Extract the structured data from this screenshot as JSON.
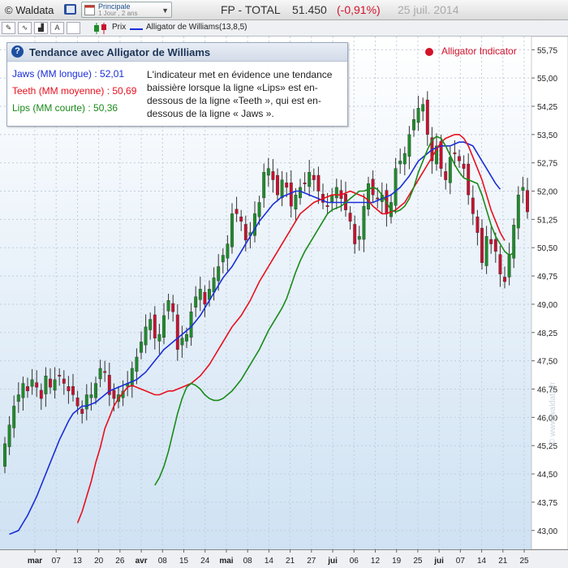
{
  "header": {
    "app_name": "© Waldata",
    "period_main": "Principale",
    "period_sub": "1 Jour , 2 ans",
    "instrument": "FP - TOTAL",
    "price": "51.450",
    "change": "(-0,91%)",
    "date": "25 juil. 2014"
  },
  "toolbar": {
    "legend_price": "Prix",
    "legend_alligator": "Alligator de Williams(13,8,5)"
  },
  "info": {
    "title": "Tendance avec Alligator de Williams",
    "jaws": "Jaws  (MM longue)  : 52,01",
    "teeth": "Teeth (MM moyenne) : 50,69",
    "lips": "Lips  (MM courte)  : 50,36",
    "description": "L'indicateur met en évidence une tendance baissière lorsque la ligne «Lips» est en-dessous de la ligne «Teeth », qui est en-dessous de la ligne « Jaws »."
  },
  "indicator_label": "Alligator Indicator",
  "watermark_text": "© www.waldata.fr",
  "colors": {
    "jaws": "#1a2ed8",
    "teeth": "#e8101e",
    "lips": "#1a8a1a",
    "up": "#1e8c2a",
    "down": "#c8102e"
  },
  "chart_data": {
    "type": "candlestick",
    "ylim": [
      42.5,
      56.1
    ],
    "yticks": [
      "43,00",
      "43,75",
      "44,50",
      "45,25",
      "46,00",
      "46,75",
      "47,50",
      "48,25",
      "49,00",
      "49,75",
      "50,50",
      "51,25",
      "52,00",
      "52,75",
      "53,50",
      "54,25",
      "55,00",
      "55,75"
    ],
    "xticks": [
      "mar",
      "07",
      "13",
      "20",
      "26",
      "avr",
      "08",
      "15",
      "24",
      "mai",
      "08",
      "14",
      "21",
      "27",
      "jui",
      "06",
      "12",
      "19",
      "25",
      "jui",
      "07",
      "14",
      "21",
      "25"
    ],
    "closes": [
      45.3,
      45.8,
      46.3,
      46.6,
      46.9,
      46.7,
      47.0,
      46.8,
      46.5,
      47.1,
      46.8,
      47.0,
      47.1,
      46.9,
      46.7,
      46.6,
      46.3,
      46.1,
      46.6,
      46.6,
      46.9,
      47.3,
      47.2,
      46.6,
      46.5,
      46.6,
      46.7,
      46.9,
      47.3,
      47.6,
      48.0,
      48.4,
      48.6,
      48.1,
      48.2,
      48.7,
      49.1,
      48.8,
      47.8,
      48.1,
      48.2,
      48.8,
      49.2,
      49.4,
      49.0,
      49.4,
      49.7,
      50.0,
      50.3,
      50.6,
      51.4,
      51.4,
      51.2,
      50.7,
      50.9,
      51.4,
      51.7,
      52.5,
      52.6,
      52.3,
      51.9,
      52.3,
      52.1,
      51.6,
      51.9,
      52.1,
      52.2,
      52.5,
      52.3,
      52.0,
      51.7,
      51.6,
      51.9,
      52.1,
      51.8,
      51.5,
      51.2,
      50.6,
      50.8,
      51.6,
      52.2,
      51.9,
      51.8,
      51.9,
      51.4,
      51.7,
      52.6,
      52.8,
      53.0,
      53.5,
      53.9,
      54.2,
      54.3,
      53.5,
      52.8,
      53.2,
      52.6,
      52.3,
      52.9,
      53.0,
      52.8,
      52.6,
      51.9,
      51.4,
      50.9,
      50.1,
      50.8,
      50.6,
      50.4,
      49.8,
      49.6,
      50.3,
      51.1,
      51.9,
      52.1,
      51.45
    ],
    "jaws": [
      42.9,
      42.95,
      43.0,
      43.2,
      43.4,
      43.65,
      43.9,
      44.2,
      44.5,
      44.8,
      45.1,
      45.4,
      45.65,
      45.9,
      46.1,
      46.2,
      46.3,
      46.3,
      46.35,
      46.4,
      46.5,
      46.6,
      46.7,
      46.75,
      46.8,
      46.85,
      46.9,
      46.95,
      47.0,
      47.1,
      47.2,
      47.35,
      47.5,
      47.65,
      47.8,
      47.9,
      48.0,
      48.1,
      48.2,
      48.3,
      48.4,
      48.55,
      48.7,
      48.9,
      49.1,
      49.3,
      49.5,
      49.7,
      49.85,
      50.0,
      50.2,
      50.4,
      50.6,
      50.8,
      51.0,
      51.2,
      51.35,
      51.5,
      51.65,
      51.75,
      51.85,
      51.9,
      51.95,
      52.0,
      52.0,
      51.95,
      51.9,
      51.85,
      51.8,
      51.75,
      51.7,
      51.7,
      51.7,
      51.7,
      51.7,
      51.7,
      51.7,
      51.7,
      51.7,
      51.7,
      51.7,
      51.75,
      51.8,
      51.85,
      51.9,
      52.0,
      52.1,
      52.25,
      52.4,
      52.6,
      52.8,
      52.9,
      53.0,
      53.1,
      53.15,
      53.2,
      53.2,
      53.2,
      53.25,
      53.3,
      53.3,
      53.25,
      53.2,
      53.0,
      52.8,
      52.6,
      52.4,
      52.2,
      52.05
    ],
    "teeth": [
      43.2,
      43.5,
      43.9,
      44.3,
      44.8,
      45.2,
      45.7,
      46.0,
      46.3,
      46.5,
      46.65,
      46.8,
      46.85,
      46.8,
      46.75,
      46.7,
      46.65,
      46.6,
      46.6,
      46.65,
      46.7,
      46.7,
      46.75,
      46.8,
      46.85,
      46.9,
      47.0,
      47.1,
      47.25,
      47.4,
      47.6,
      47.8,
      48.0,
      48.2,
      48.4,
      48.55,
      48.7,
      48.9,
      49.1,
      49.35,
      49.6,
      49.8,
      50.0,
      50.2,
      50.4,
      50.6,
      50.8,
      51.0,
      51.2,
      51.4,
      51.5,
      51.6,
      51.7,
      51.75,
      51.8,
      51.85,
      51.9,
      51.9,
      51.9,
      51.95,
      52.0,
      51.95,
      51.9,
      51.85,
      51.75,
      51.6,
      51.5,
      51.4,
      51.4,
      51.45,
      51.5,
      51.6,
      51.7,
      51.9,
      52.1,
      52.3,
      52.5,
      52.7,
      52.9,
      53.1,
      53.3,
      53.4,
      53.45,
      53.5,
      53.5,
      53.4,
      53.2,
      52.9,
      52.6,
      52.3,
      51.9,
      51.5,
      51.2,
      50.9,
      50.69
    ],
    "lips": [
      44.2,
      44.4,
      44.7,
      45.1,
      45.6,
      46.1,
      46.5,
      46.8,
      46.9,
      46.85,
      46.75,
      46.6,
      46.5,
      46.45,
      46.45,
      46.5,
      46.6,
      46.7,
      46.85,
      47.0,
      47.2,
      47.4,
      47.6,
      47.8,
      48.05,
      48.3,
      48.5,
      48.7,
      48.9,
      49.15,
      49.5,
      49.85,
      50.15,
      50.4,
      50.6,
      50.8,
      51.0,
      51.2,
      51.4,
      51.5,
      51.55,
      51.6,
      51.7,
      51.8,
      51.9,
      52.0,
      52.0,
      52.05,
      52.1,
      52.05,
      51.9,
      51.7,
      51.5,
      51.45,
      51.5,
      51.6,
      51.8,
      52.1,
      52.5,
      52.8,
      53.1,
      53.35,
      53.45,
      53.4,
      53.2,
      52.95,
      52.7,
      52.5,
      52.35,
      52.3,
      52.25,
      52.2,
      51.9,
      51.5,
      51.1,
      50.8,
      50.6,
      50.4,
      50.3,
      50.36
    ]
  }
}
